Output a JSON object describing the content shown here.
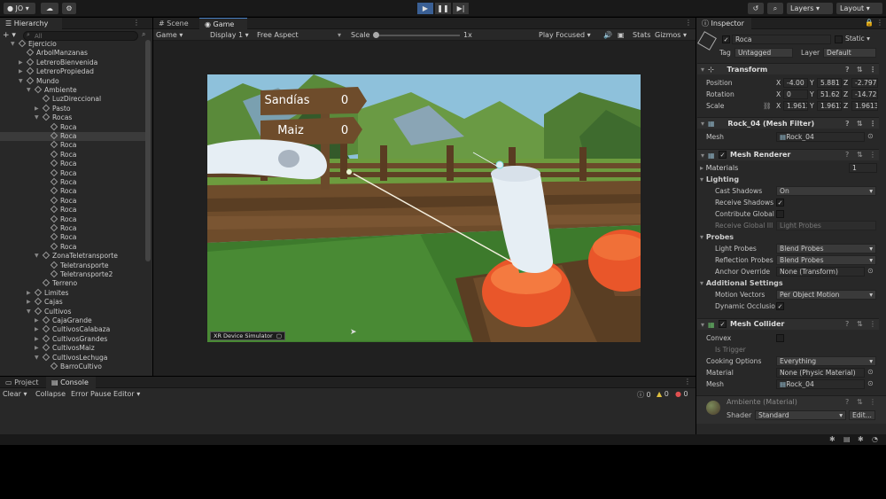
{
  "toolbar": {
    "account": "JO",
    "layers": "Layers",
    "layout": "Layout"
  },
  "hierarchy": {
    "tab": "Hierarchy",
    "search_placeholder": "All",
    "rows": [
      {
        "label": "Ejercicio",
        "indent": 0,
        "arrow": "▼",
        "sel": false,
        "icon": "unity"
      },
      {
        "label": "ArbolManzanas",
        "indent": 1,
        "arrow": "",
        "sel": false
      },
      {
        "label": "LetreroBienvenida",
        "indent": 1,
        "arrow": "▶",
        "sel": false
      },
      {
        "label": "LetreroPropiedad",
        "indent": 1,
        "arrow": "▶",
        "sel": false
      },
      {
        "label": "Mundo",
        "indent": 1,
        "arrow": "▼",
        "sel": false
      },
      {
        "label": "Ambiente",
        "indent": 2,
        "arrow": "▼",
        "sel": false
      },
      {
        "label": "LuzDireccional",
        "indent": 3,
        "arrow": "",
        "sel": false
      },
      {
        "label": "Pasto",
        "indent": 3,
        "arrow": "▶",
        "sel": false
      },
      {
        "label": "Rocas",
        "indent": 3,
        "arrow": "▼",
        "sel": false
      },
      {
        "label": "Roca",
        "indent": 4,
        "arrow": "",
        "sel": false
      },
      {
        "label": "Roca",
        "indent": 4,
        "arrow": "",
        "sel": true
      },
      {
        "label": "Roca",
        "indent": 4,
        "arrow": "",
        "sel": false
      },
      {
        "label": "Roca",
        "indent": 4,
        "arrow": "",
        "sel": false
      },
      {
        "label": "Roca",
        "indent": 4,
        "arrow": "",
        "sel": false
      },
      {
        "label": "Roca",
        "indent": 4,
        "arrow": "",
        "sel": false
      },
      {
        "label": "Roca",
        "indent": 4,
        "arrow": "",
        "sel": false
      },
      {
        "label": "Roca",
        "indent": 4,
        "arrow": "",
        "sel": false
      },
      {
        "label": "Roca",
        "indent": 4,
        "arrow": "",
        "sel": false
      },
      {
        "label": "Roca",
        "indent": 4,
        "arrow": "",
        "sel": false
      },
      {
        "label": "Roca",
        "indent": 4,
        "arrow": "",
        "sel": false
      },
      {
        "label": "Roca",
        "indent": 4,
        "arrow": "",
        "sel": false
      },
      {
        "label": "Roca",
        "indent": 4,
        "arrow": "",
        "sel": false
      },
      {
        "label": "Roca",
        "indent": 4,
        "arrow": "",
        "sel": false
      },
      {
        "label": "ZonaTeletransporte",
        "indent": 3,
        "arrow": "▼",
        "sel": false
      },
      {
        "label": "Teletransporte",
        "indent": 4,
        "arrow": "",
        "sel": false
      },
      {
        "label": "Teletransporte2",
        "indent": 4,
        "arrow": "",
        "sel": false
      },
      {
        "label": "Terreno",
        "indent": 3,
        "arrow": "",
        "sel": false
      },
      {
        "label": "Limites",
        "indent": 2,
        "arrow": "▶",
        "sel": false
      },
      {
        "label": "Cajas",
        "indent": 2,
        "arrow": "▶",
        "sel": false
      },
      {
        "label": "Cultivos",
        "indent": 2,
        "arrow": "▼",
        "sel": false
      },
      {
        "label": "CajaGrande",
        "indent": 3,
        "arrow": "▶",
        "sel": false
      },
      {
        "label": "CultivosCalabaza",
        "indent": 3,
        "arrow": "▶",
        "sel": false
      },
      {
        "label": "CultivosGrandes",
        "indent": 3,
        "arrow": "▶",
        "sel": false
      },
      {
        "label": "CultivosMaiz",
        "indent": 3,
        "arrow": "▶",
        "sel": false
      },
      {
        "label": "CultivosLechuga",
        "indent": 3,
        "arrow": "▼",
        "sel": false
      },
      {
        "label": "BarroCultivo",
        "indent": 4,
        "arrow": "",
        "sel": false
      }
    ]
  },
  "scene_tabs": {
    "scene": "Scene",
    "game": "Game"
  },
  "game_bar": {
    "mode": "Game",
    "display": "Display 1",
    "aspect": "Free Aspect",
    "scale_label": "Scale",
    "scale_value": "1x",
    "play_focused": "Play Focused",
    "stats": "Stats",
    "gizmos": "Gizmos"
  },
  "game_view": {
    "sign1_label": "Sandías",
    "sign1_value": "0",
    "sign2_label": "Maiz",
    "sign2_value": "0",
    "simulator": "XR Device Simulator"
  },
  "bottom": {
    "tab_project": "Project",
    "tab_console": "Console",
    "clear": "Clear",
    "collapse": "Collapse",
    "error_pause": "Error Pause",
    "editor": "Editor",
    "count_info": "0",
    "count_warn": "0",
    "count_error": "0"
  },
  "inspector": {
    "tab": "Inspector",
    "name": "Roca",
    "static": "Static",
    "tag_label": "Tag",
    "tag": "Untagged",
    "layer_label": "Layer",
    "layer": "Default",
    "transform": {
      "title": "Transform",
      "position_label": "Position",
      "position": {
        "x": "-4.00",
        "y": "5.881",
        "z": "-2.797"
      },
      "rotation_label": "Rotation",
      "rotation": {
        "x": "0",
        "y": "51.62",
        "z": "-14.72"
      },
      "scale_label": "Scale",
      "scale": {
        "x": "1.9613",
        "y": "1.9613",
        "z": "1.9613"
      }
    },
    "mesh_filter": {
      "title": "Rock_04 (Mesh Filter)",
      "mesh_label": "Mesh",
      "mesh": "Rock_04"
    },
    "mesh_renderer": {
      "title": "Mesh Renderer",
      "materials_label": "Materials",
      "materials_count": "1",
      "lighting": "Lighting",
      "cast_shadows_label": "Cast Shadows",
      "cast_shadows": "On",
      "receive_shadows_label": "Receive Shadows",
      "contribute_gi_label": "Contribute Global",
      "receive_gi_label": "Receive Global Ill",
      "receive_gi": "Light Probes",
      "probes": "Probes",
      "light_probes_label": "Light Probes",
      "light_probes": "Blend Probes",
      "reflection_label": "Reflection Probes",
      "reflection": "Blend Probes",
      "anchor_label": "Anchor Override",
      "anchor": "None (Transform)",
      "additional": "Additional Settings",
      "motion_label": "Motion Vectors",
      "motion": "Per Object Motion",
      "dynamic_label": "Dynamic Occlusio"
    },
    "mesh_collider": {
      "title": "Mesh Collider",
      "convex_label": "Convex",
      "trigger_label": "Is Trigger",
      "cooking_label": "Cooking Options",
      "cooking": "Everything",
      "material_label": "Material",
      "material": "None (Physic Material)",
      "mesh_label": "Mesh",
      "mesh": "Rock_04"
    },
    "material": {
      "name": "Ambiente (Material)",
      "shader_label": "Shader",
      "shader": "Standard",
      "edit": "Edit..."
    }
  }
}
